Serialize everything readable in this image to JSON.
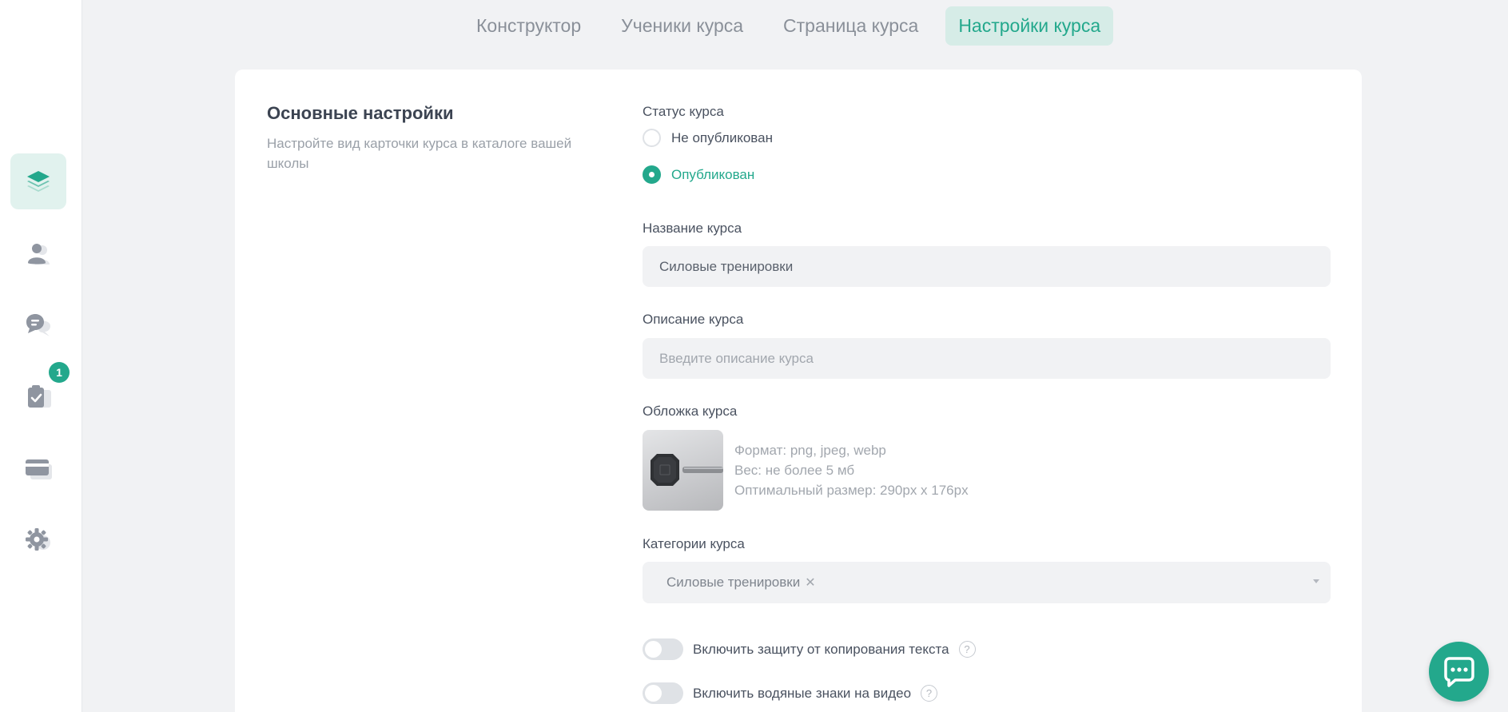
{
  "sidebar": {
    "items": [
      {
        "icon": "layers-icon",
        "active": true
      },
      {
        "icon": "users-icon"
      },
      {
        "icon": "chat-icon"
      },
      {
        "icon": "tasks-icon",
        "badge": "1"
      },
      {
        "icon": "card-icon"
      },
      {
        "icon": "gear-icon"
      }
    ]
  },
  "tabs": [
    {
      "label": "Конструктор"
    },
    {
      "label": "Ученики курса"
    },
    {
      "label": "Страница курса"
    },
    {
      "label": "Настройки курса",
      "active": true
    }
  ],
  "section": {
    "title": "Основные настройки",
    "description": "Настройте вид карточки курса в каталоге вашей школы"
  },
  "status": {
    "label": "Статус курса",
    "options": [
      "Не опубликован",
      "Опубликован"
    ],
    "selected": "Опубликован"
  },
  "course_name": {
    "label": "Название курса",
    "value": "Силовые тренировки"
  },
  "course_description": {
    "label": "Описание курса",
    "placeholder": "Введите описание курса"
  },
  "cover": {
    "label": "Обложка курса",
    "format": "Формат: png, jpeg, webp",
    "weight": "Вес: не более 5 мб",
    "size": "Оптимальный размер: 290px x 176px"
  },
  "categories": {
    "label": "Категории курса",
    "selected": "Силовые тренировки"
  },
  "toggles": [
    {
      "label": "Включить защиту от копирования текста",
      "on": false
    },
    {
      "label": "Включить водяные знаки на видео",
      "on": false
    }
  ],
  "colors": {
    "accent": "#23a88c",
    "accent_bg": "#d6ece7",
    "page_bg": "#f1f2f4"
  }
}
